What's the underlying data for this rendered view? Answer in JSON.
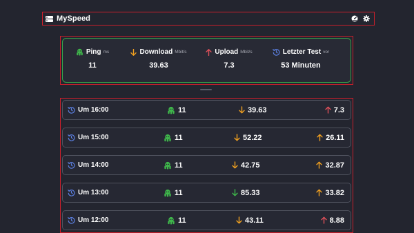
{
  "app": {
    "title": "MySpeed"
  },
  "colors": {
    "ping_icon": "#3fb74b",
    "down_orange": "#f1a020",
    "down_green": "#3fb74b",
    "up_red": "#e0505a",
    "up_orange": "#f1a020",
    "history_icon": "#5b7fe0"
  },
  "summary": {
    "ping": {
      "label": "Ping",
      "unit": "ms",
      "value": "11",
      "icon": "ping-icon"
    },
    "download": {
      "label": "Download",
      "unit": "Mbit/s",
      "value": "39.63",
      "icon": "arrow-down-icon"
    },
    "upload": {
      "label": "Upload",
      "unit": "Mbit/s",
      "value": "7.3",
      "icon": "arrow-up-icon"
    },
    "last_test": {
      "label": "Letzter Test",
      "unit": "vor",
      "value": "53 Minuten",
      "icon": "history-icon"
    }
  },
  "history": [
    {
      "time": "Um 16:00",
      "ping": "11",
      "download": "39.63",
      "upload": "7.3",
      "down_color": "orange",
      "up_color": "red"
    },
    {
      "time": "Um 15:00",
      "ping": "11",
      "download": "52.22",
      "upload": "26.11",
      "down_color": "orange",
      "up_color": "orange"
    },
    {
      "time": "Um 14:00",
      "ping": "11",
      "download": "42.75",
      "upload": "32.87",
      "down_color": "orange",
      "up_color": "orange"
    },
    {
      "time": "Um 13:00",
      "ping": "11",
      "download": "85.33",
      "upload": "33.82",
      "down_color": "green",
      "up_color": "orange"
    },
    {
      "time": "Um 12:00",
      "ping": "11",
      "download": "43.11",
      "upload": "8.88",
      "down_color": "orange",
      "up_color": "red"
    }
  ]
}
